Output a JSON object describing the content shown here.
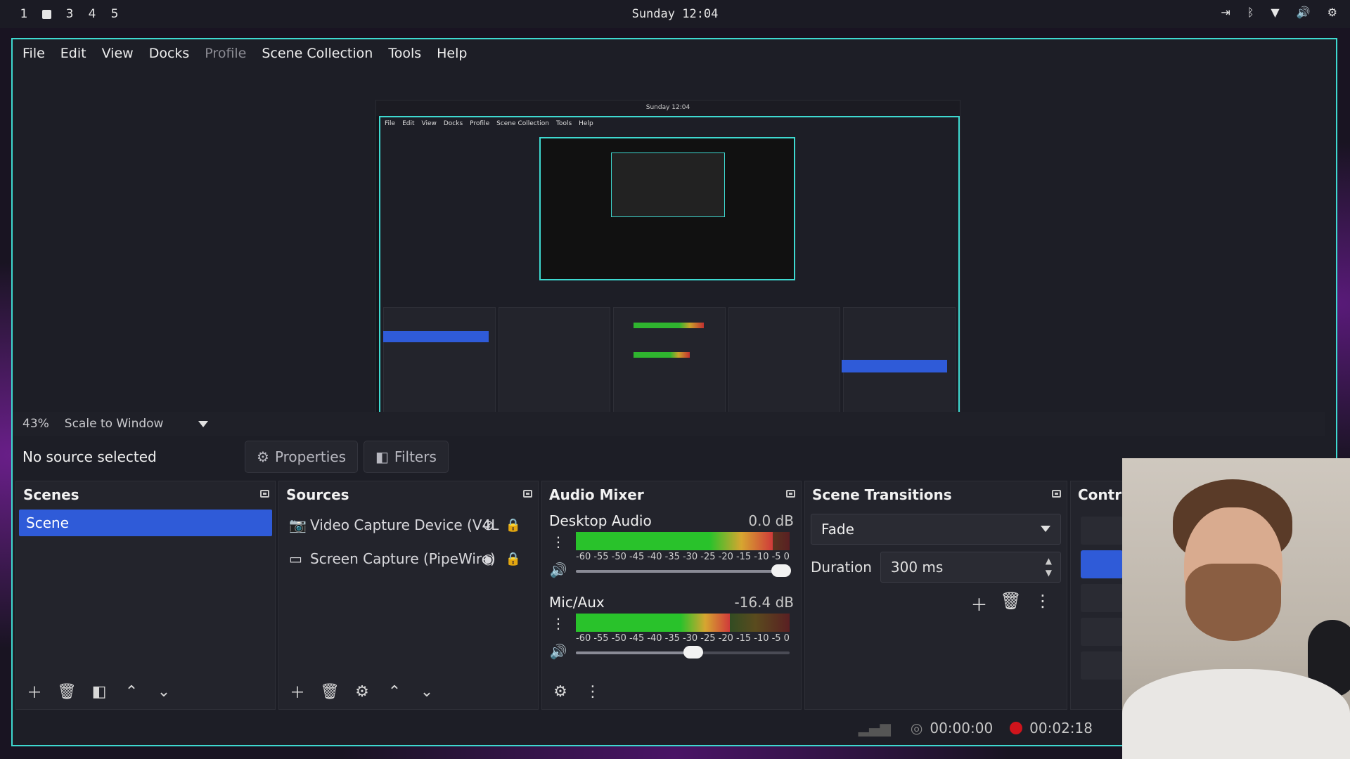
{
  "system": {
    "workspaces": [
      "1",
      "",
      "3",
      "4",
      "5"
    ],
    "clock": "Sunday 12:04"
  },
  "menu": [
    "File",
    "Edit",
    "View",
    "Docks",
    "Profile",
    "Scene Collection",
    "Tools",
    "Help"
  ],
  "zoom": {
    "percent": "43%",
    "mode": "Scale to Window"
  },
  "source_bar": {
    "status": "No source selected",
    "properties": "Properties",
    "filters": "Filters"
  },
  "scenes": {
    "title": "Scenes",
    "items": [
      "Scene"
    ]
  },
  "sources": {
    "title": "Sources",
    "items": [
      "Video Capture Device (V4L",
      "Screen Capture (PipeWire)"
    ]
  },
  "audio_mixer": {
    "title": "Audio Mixer",
    "channels": [
      {
        "name": "Desktop Audio",
        "db": "0.0 dB",
        "level": 0.92,
        "volume": 0.96
      },
      {
        "name": "Mic/Aux",
        "db": "-16.4 dB",
        "level": 0.72,
        "volume": 0.55
      }
    ],
    "scale": [
      "-60",
      "-55",
      "-50",
      "-45",
      "-40",
      "-35",
      "-30",
      "-25",
      "-20",
      "-15",
      "-10",
      "-5",
      "0"
    ]
  },
  "scene_transitions": {
    "title": "Scene Transitions",
    "transition": "Fade",
    "duration_label": "Duration",
    "duration": "300 ms"
  },
  "controls": {
    "title": "Contr"
  },
  "status": {
    "stream_time": "00:00:00",
    "rec_time": "00:02:18"
  },
  "nested": {
    "clock": "Sunday 12:04",
    "menu": [
      "File",
      "Edit",
      "View",
      "Docks",
      "Profile",
      "Scene Collection",
      "Tools",
      "Help"
    ]
  },
  "colors": {
    "accent": "#2f5bd8",
    "window_border": "#3ed9d0",
    "rec": "#d0141c"
  }
}
